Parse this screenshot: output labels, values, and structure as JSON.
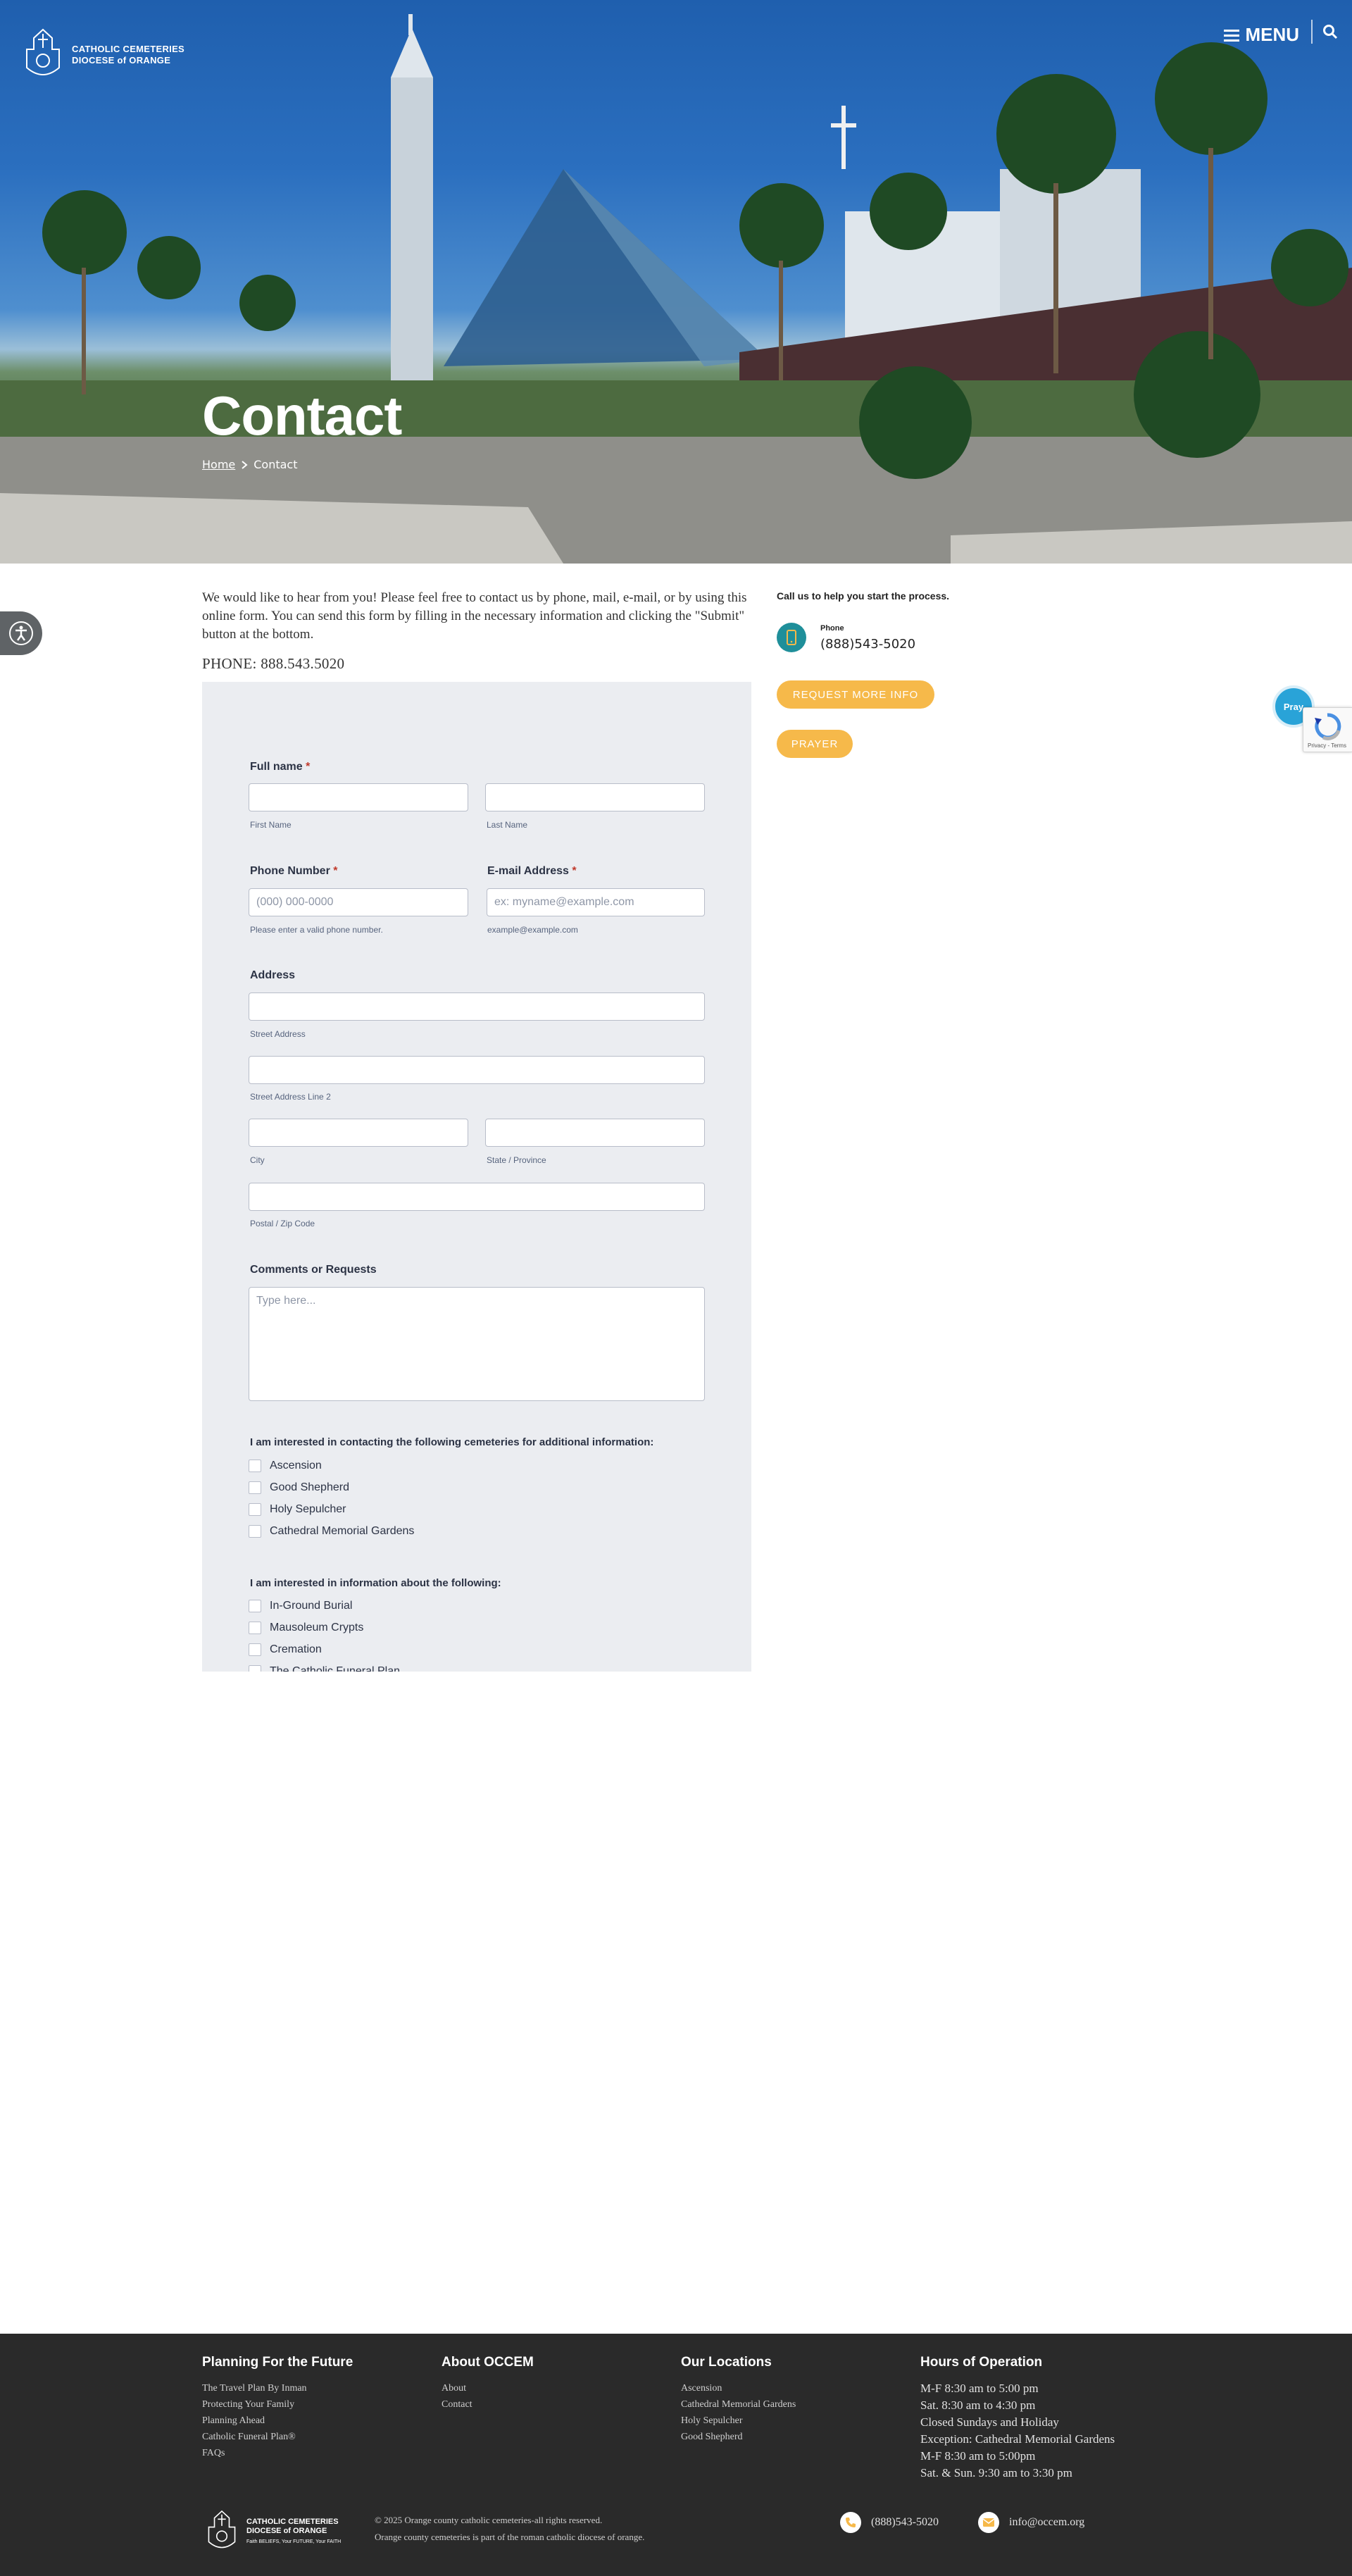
{
  "header": {
    "logo_line1": "CATHOLIC CEMETERIES",
    "logo_line2": "DIOCESE of ORANGE",
    "menu_label": "MENU"
  },
  "hero": {
    "title": "Contact",
    "breadcrumb": [
      {
        "label": "Home"
      },
      {
        "label": "Contact"
      }
    ]
  },
  "intro": {
    "text": "We would like to hear from you! Please feel free to contact us by phone, mail, e-mail, or by using this online form. You can send this form by filling in the necessary information and clicking the \"Submit\" button at the bottom.",
    "phone": "PHONE: 888.543.5020"
  },
  "form": {
    "full_name_label": "Full name",
    "first_name_sub": "First Name",
    "last_name_sub": "Last Name",
    "phone_label": "Phone Number",
    "phone_placeholder": "(000) 000-0000",
    "phone_sub": "Please enter a valid phone number.",
    "email_label": "E-mail Address",
    "email_placeholder": "ex: myname@example.com",
    "email_sub": "example@example.com",
    "address_label": "Address",
    "street_sub": "Street Address",
    "street2_sub": "Street Address Line 2",
    "city_sub": "City",
    "state_sub": "State / Province",
    "zip_sub": "Postal / Zip Code",
    "comments_label": "Comments or Requests",
    "comments_placeholder": "Type here...",
    "required_mark": "*",
    "cemeteries_label": "I am interested in contacting the following cemeteries for additional information:",
    "cemeteries": [
      "Ascension",
      "Good Shepherd",
      "Holy Sepulcher",
      "Cathedral Memorial Gardens"
    ],
    "interest_label": "I am interested in information about the following:",
    "interests": [
      "In-Ground Burial",
      "Mausoleum Crypts",
      "Cremation",
      "The Catholic Funeral Plan"
    ]
  },
  "sidebar": {
    "help_text": "Call us to help you start the process.",
    "phone_label": "Phone",
    "phone_number": "(888)543-5020",
    "request_button": "REQUEST MORE INFO",
    "prayer_button": "PRAYER",
    "pray_fab": "Pray"
  },
  "recaptcha": {
    "links": "Privacy - Terms"
  },
  "footer": {
    "col1": {
      "title": "Planning For the Future",
      "links": [
        "The Travel Plan By Inman",
        "Protecting Your Family",
        "Planning Ahead",
        "Catholic Funeral Plan®",
        "FAQs"
      ]
    },
    "col2": {
      "title": "About OCCEM",
      "links": [
        "About",
        "Contact"
      ]
    },
    "col3": {
      "title": "Our Locations",
      "links": [
        "Ascension",
        "Cathedral Memorial Gardens",
        "Holy Sepulcher",
        "Good Shepherd"
      ]
    },
    "col4": {
      "title": "Hours of Operation",
      "lines": [
        "M-F 8:30 am to 5:00 pm",
        "Sat. 8:30 am to 4:30 pm",
        "Closed Sundays and Holiday",
        "Exception: Cathedral Memorial Gardens",
        "M-F 8:30 am to 5:00pm",
        "Sat. & Sun. 9:30 am to 3:30 pm"
      ]
    },
    "logo_line1": "CATHOLIC CEMETERIES",
    "logo_line2": "DIOCESE of ORANGE",
    "logo_tagline": "Faith BELIEFS, Your FUTURE, Your FAITH",
    "copyright": "© 2025 Orange county catholic cemeteries-all rights reserved.",
    "copyright2": "Orange county cemeteries is part of the roman catholic diocese of orange.",
    "phone": "(888)543-5020",
    "email": "info@occem.org"
  },
  "colors": {
    "accent_pill": "#f6b94a",
    "teal": "#1f8f9a",
    "footer_bg": "#2a2a2a",
    "form_bg": "#ebedf1"
  }
}
